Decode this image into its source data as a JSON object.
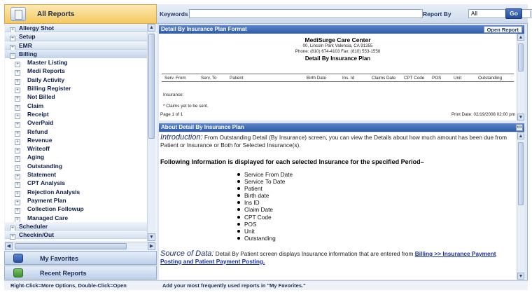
{
  "sidebar": {
    "title": "All Reports",
    "tree": [
      {
        "label": "Allergy Shot",
        "level": 0,
        "expanded": false
      },
      {
        "label": "Setup",
        "level": 0,
        "expanded": false
      },
      {
        "label": "EMR",
        "level": 0,
        "expanded": false
      },
      {
        "label": "Billing",
        "level": 0,
        "expanded": true
      },
      {
        "label": "Master Listing",
        "level": 1
      },
      {
        "label": "Medi Reports",
        "level": 1
      },
      {
        "label": "Daily Activity",
        "level": 1
      },
      {
        "label": "Billing Register",
        "level": 1
      },
      {
        "label": "Not Billed",
        "level": 1
      },
      {
        "label": "Claim",
        "level": 1
      },
      {
        "label": "Receipt",
        "level": 1
      },
      {
        "label": "OverPaid",
        "level": 1
      },
      {
        "label": "Refund",
        "level": 1
      },
      {
        "label": "Revenue",
        "level": 1
      },
      {
        "label": "Writeoff",
        "level": 1
      },
      {
        "label": "Aging",
        "level": 1
      },
      {
        "label": "Outstanding",
        "level": 1
      },
      {
        "label": "Statement",
        "level": 1
      },
      {
        "label": "CPT Analysis",
        "level": 1
      },
      {
        "label": "Rejection Analysis",
        "level": 1
      },
      {
        "label": "Payment Plan",
        "level": 1
      },
      {
        "label": "Collection Followup",
        "level": 1
      },
      {
        "label": "Managed Care",
        "level": 1
      },
      {
        "label": "Scheduler",
        "level": 0,
        "expanded": false
      },
      {
        "label": "Checkin/Out",
        "level": 0,
        "expanded": false
      }
    ],
    "favorites_label": "My Favorites",
    "recent_label": "Recent Reports"
  },
  "toolbar": {
    "keywords_label": "Keywords",
    "keywords_value": "",
    "report_by_label": "Report By",
    "report_by_value": "All",
    "go_label": "Go"
  },
  "report_panel": {
    "header": "Detail By Insurance Plan Format",
    "open_report_label": "Open Report",
    "clinic_name": "MediSurge Care Center",
    "address": "00, Lincoln Park   Valencia, CA 91355",
    "phone": "Phone: (810) 674-4103  Fax: (810) 553-1558",
    "report_title": "Detail By Insurance Plan",
    "columns": [
      "Serv. From",
      "Serv. To",
      "Patient",
      "Birth Date",
      "Ins. Id",
      "Claims Date",
      "CPT Code",
      "POS",
      "Unit",
      "Outstanding"
    ],
    "insurance_label": "Insurance:",
    "note": "* Claims yet to be sent.",
    "page_info": "Page 1 of 1",
    "print_date": "Print Date: 02/19/2008 02:00 pm"
  },
  "about_panel": {
    "header": "About Detail By Insurance Plan",
    "intro_lead": "Introduction:",
    "intro_text": "From Outstanding Detail (By Insurance) screen, you can view the Details about how much amount has been due from Patient or Insurance or Both for Selected Insurance(s).",
    "following": "Following Information is displayed for each selected Insurance for the specified Period–",
    "fields": [
      "Service From Date",
      "Service To Date",
      "Patient",
      "Birth date",
      "Ins ID",
      "Claim Date",
      "CPT Code",
      "POS",
      "Unit",
      "Outstanding"
    ],
    "source_lead": "Source of Data:",
    "source_text": "Detail By Patient screen displays Insurance information that are entered from",
    "source_link": "Billing >> Insurance Payment Posting and Patient Payment Posting."
  },
  "status": {
    "left": "Right-Click=More Options, Double-Click=Open",
    "right": "Add your most frequently used reports in \"My Favorites.\""
  },
  "colors": {
    "header_blue": "#2f5ba6",
    "accent_orange": "#f4c95e",
    "link_blue": "#1a2fa8"
  }
}
